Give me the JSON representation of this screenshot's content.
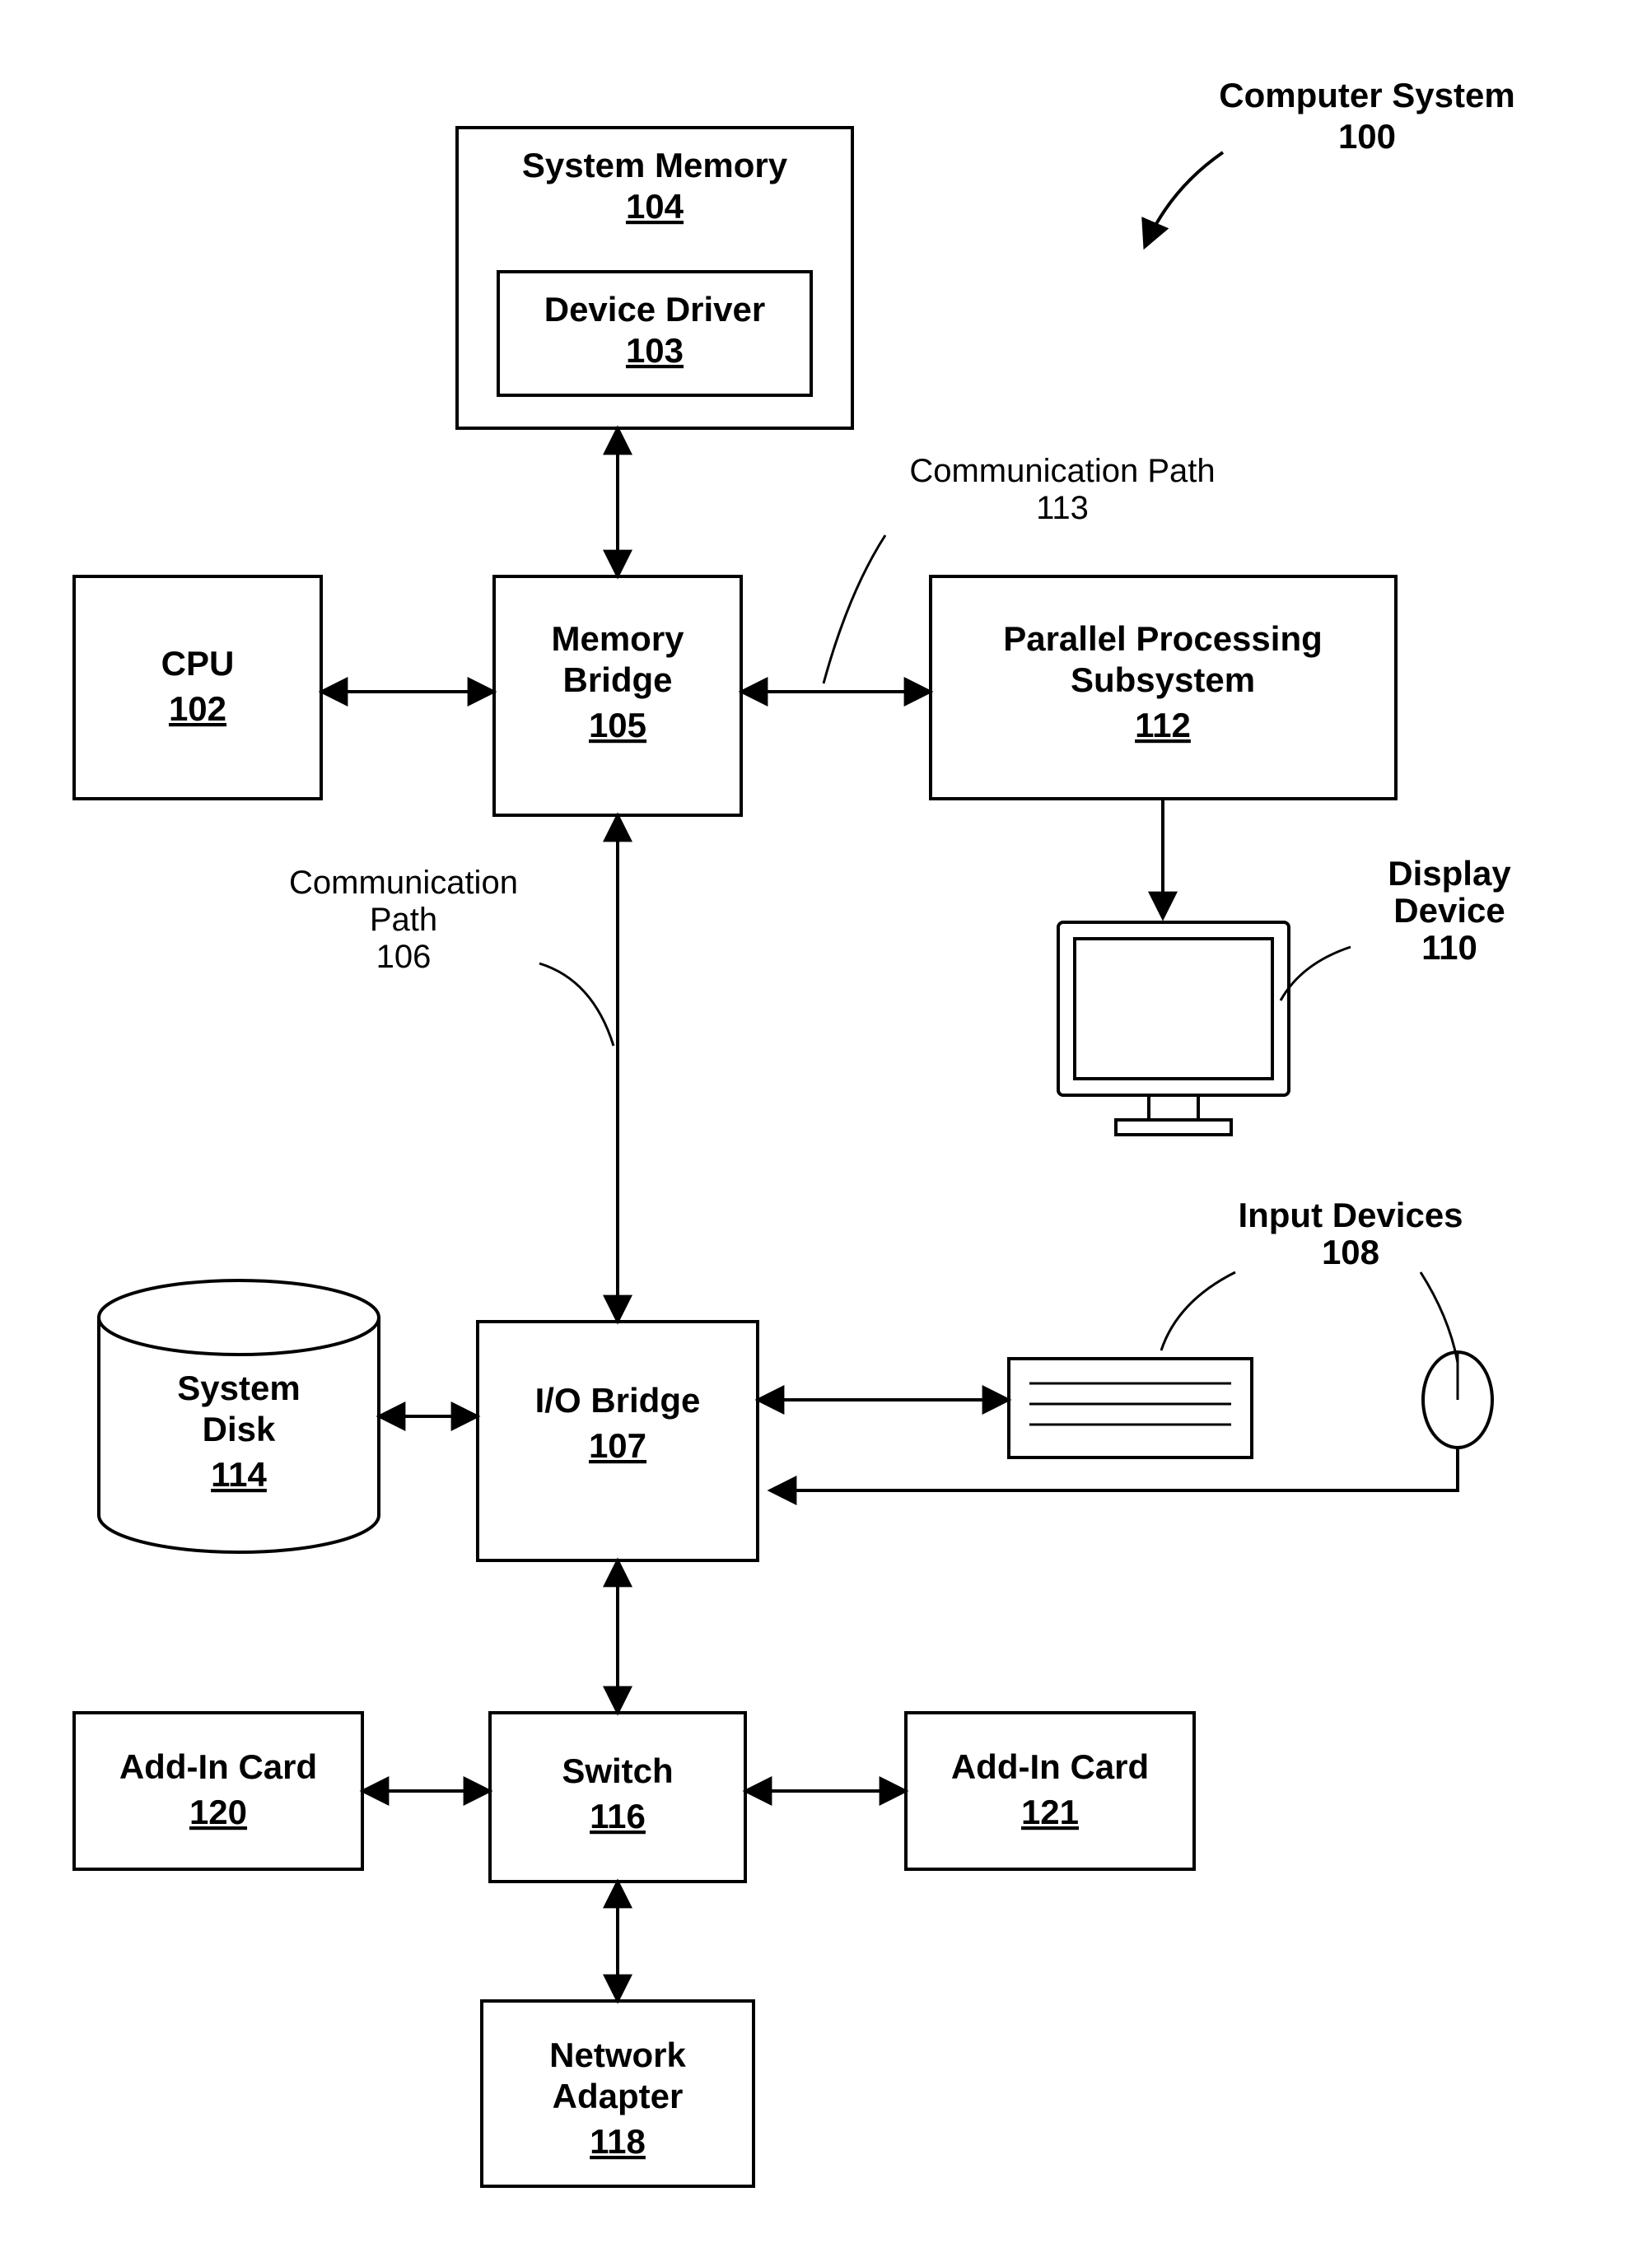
{
  "system": {
    "title": "Computer System",
    "ref": "100"
  },
  "sysMem": {
    "title": "System Memory",
    "ref": "104"
  },
  "devDriver": {
    "title": "Device Driver",
    "ref": "103"
  },
  "cpu": {
    "title": "CPU",
    "ref": "102"
  },
  "memBridge": {
    "title1": "Memory",
    "title2": "Bridge",
    "ref": "105"
  },
  "pps": {
    "title1": "Parallel Processing",
    "title2": "Subsystem",
    "ref": "112"
  },
  "commPath113": {
    "title": "Communication Path",
    "ref": "113"
  },
  "commPath106": {
    "title1": "Communication",
    "title2": "Path",
    "ref": "106"
  },
  "display": {
    "title1": "Display",
    "title2": "Device",
    "ref": "110"
  },
  "sysDisk": {
    "title1": "System",
    "title2": "Disk",
    "ref": "114"
  },
  "ioBridge": {
    "title": "I/O Bridge",
    "ref": "107"
  },
  "inputDev": {
    "title": "Input Devices",
    "ref": "108"
  },
  "addIn120": {
    "title": "Add-In Card",
    "ref": "120"
  },
  "switch": {
    "title": "Switch",
    "ref": "116"
  },
  "addIn121": {
    "title": "Add-In Card",
    "ref": "121"
  },
  "netAdapter": {
    "title1": "Network",
    "title2": "Adapter",
    "ref": "118"
  }
}
